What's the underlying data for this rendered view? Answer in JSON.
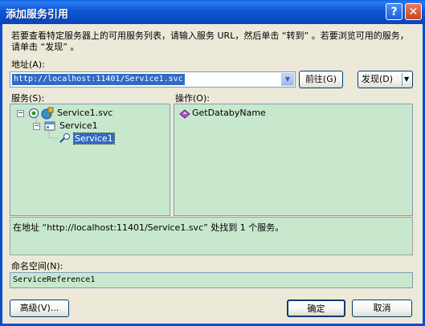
{
  "window": {
    "title": "添加服务引用",
    "help_glyph": "?",
    "close_glyph": "✕"
  },
  "intro_text": "若要查看特定服务器上的可用服务列表，请输入服务 URL，然后单击 “转到” 。若要浏览可用的服务，请单击 “发现” 。",
  "address": {
    "label": "地址(A):",
    "value": "http://localhost:11401/Service1.svc",
    "go_button": "前往(G)",
    "discover_button": "发现(D)"
  },
  "services": {
    "label": "服务(S):",
    "tree": {
      "root": "Service1.svc",
      "child": "Service1",
      "leaf": "Service1"
    }
  },
  "operations": {
    "label": "操作(O):",
    "items": [
      "GetDatabyName"
    ]
  },
  "status_text": "在地址 “http://localhost:11401/Service1.svc” 处找到 1 个服务。",
  "namespace": {
    "label": "命名空间(N):",
    "value": "ServiceReference1"
  },
  "buttons": {
    "advanced": "高级(V)...",
    "ok": "确定",
    "cancel": "取消"
  }
}
